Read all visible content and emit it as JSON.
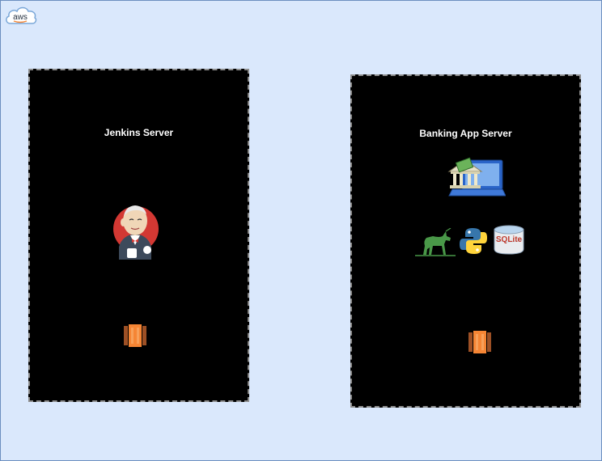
{
  "aws_logo": {
    "text": "aws"
  },
  "servers": [
    {
      "title": "Jenkins Server",
      "icons": [
        "jenkins-icon",
        "ec2-instance-icon"
      ]
    },
    {
      "title": "Banking App Server",
      "icons": [
        "banking-app-icon",
        "gunicorn-icon",
        "python-icon",
        "sqlite-icon",
        "ec2-instance-icon"
      ]
    }
  ],
  "sqlite_label": "SQLite",
  "colors": {
    "background": "#dae8fc",
    "box_fill": "#000000",
    "ec2_orange": "#f58534",
    "jenkins_red": "#d33833",
    "gunicorn_green": "#499848"
  }
}
